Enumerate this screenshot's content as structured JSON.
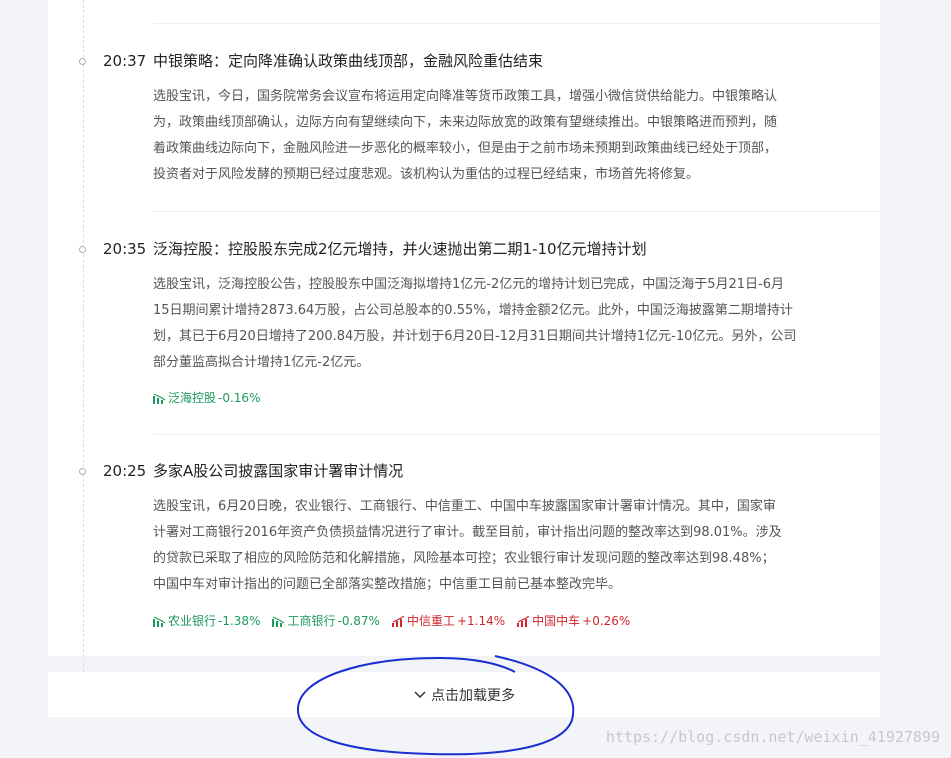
{
  "news": [
    {
      "time": "20:37",
      "title": "中银策略：定向降准确认政策曲线顶部，金融风险重估结束",
      "lines": [
        "选股宝讯，今日，国务院常务会议宣布将运用定向降准等货币政策工具，增强小微信贷供给能力。中银策略认",
        "为，政策曲线顶部确认，边际方向有望继续向下，未来边际放宽的政策有望继续推出。中银策略进而预判，随",
        "着政策曲线边际向下，金融风险进一步恶化的概率较小，但是由于之前市场未预期到政策曲线已经处于顶部，",
        "投资者对于风险发酵的预期已经过度悲观。该机构认为重估的过程已经结束，市场首先将修复。"
      ],
      "stocks": []
    },
    {
      "time": "20:35",
      "title": "泛海控股：控股股东完成2亿元增持，并火速抛出第二期1-10亿元增持计划",
      "lines": [
        "选股宝讯，泛海控股公告，控股股东中国泛海拟增持1亿元-2亿元的增持计划已完成，中国泛海于5月21日-6月",
        "15日期间累计增持2873.64万股，占公司总股本的0.55%，增持金额2亿元。此外，中国泛海披露第二期增持计",
        "划，其已于6月20日增持了200.84万股，并计划于6月20日-12月31日期间共计增持1亿元-10亿元。另外，公司",
        "部分董监高拟合计增持1亿元-2亿元。"
      ],
      "stocks": [
        {
          "name": "泛海控股",
          "change": "-0.16%"
        }
      ]
    },
    {
      "time": "20:25",
      "title": "多家A股公司披露国家审计署审计情况",
      "lines": [
        "选股宝讯，6月20日晚，农业银行、工商银行、中信重工、中国中车披露国家审计署审计情况。其中，国家审",
        "计署对工商银行2016年资产负债损益情况进行了审计。截至目前，审计指出问题的整改率达到98.01%。涉及",
        "的贷款已采取了相应的风险防范和化解措施，风险基本可控；农业银行审计发现问题的整改率达到98.48%；",
        "中国中车对审计指出的问题已全部落实整改措施；中信重工目前已基本整改完毕。"
      ],
      "stocks": [
        {
          "name": "农业银行",
          "change": "-1.38%"
        },
        {
          "name": "工商银行",
          "change": "-0.87%"
        },
        {
          "name": "中信重工",
          "change": "+1.14%"
        },
        {
          "name": "中国中车",
          "change": "+0.26%"
        }
      ]
    }
  ],
  "load_more": {
    "label": "点击加载更多",
    "icon": "chevron-down-icon"
  },
  "watermark": "https://blog.csdn.net/weixin_41927899",
  "colors": {
    "down": "#1c9a5c",
    "up": "#d0262b",
    "annotation": "#1a2fd0"
  }
}
